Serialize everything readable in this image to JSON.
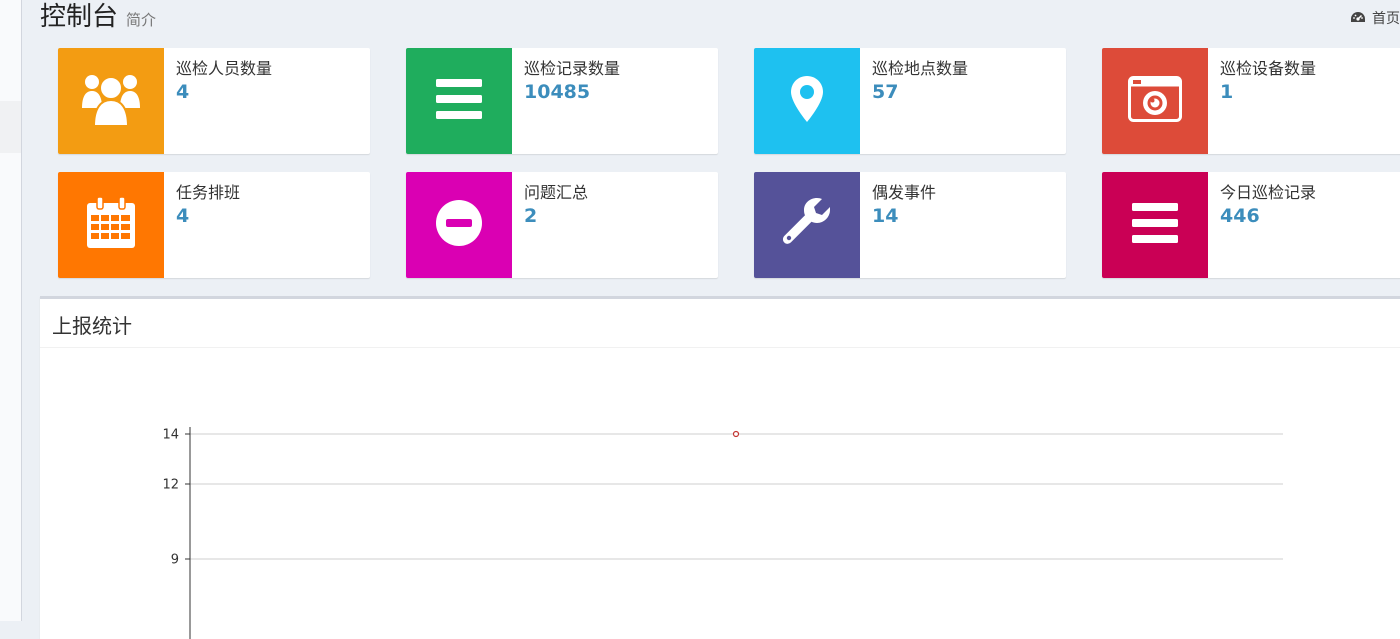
{
  "header": {
    "title": "控制台",
    "subtitle": "简介"
  },
  "breadcrumb": {
    "icon": "dashboard-icon",
    "label": "首页"
  },
  "info_boxes": [
    {
      "label": "巡检人员数量",
      "value": "4",
      "color": "#f39c12",
      "icon": "users-icon"
    },
    {
      "label": "巡检记录数量",
      "value": "10485",
      "color": "#1fad5d",
      "icon": "list-icon"
    },
    {
      "label": "巡检地点数量",
      "value": "57",
      "color": "#1ec1f0",
      "icon": "map-marker-icon"
    },
    {
      "label": "巡检设备数量",
      "value": "1",
      "color": "#dd4b39",
      "icon": "camera-icon"
    },
    {
      "label": "任务排班",
      "value": "4",
      "color": "#ff7701",
      "icon": "calendar-icon"
    },
    {
      "label": "问题汇总",
      "value": "2",
      "color": "#da00b3",
      "icon": "minus-circle-icon"
    },
    {
      "label": "偶发事件",
      "value": "14",
      "color": "#555299",
      "icon": "wrench-icon"
    },
    {
      "label": "今日巡检记录",
      "value": "446",
      "color": "#ca0055",
      "icon": "list-icon"
    }
  ],
  "panel": {
    "title": "上报统计"
  },
  "chart_data": {
    "type": "scatter",
    "y_ticks": [
      14,
      12,
      9
    ],
    "points": [
      {
        "y": 14
      }
    ],
    "point_color": "#c23531",
    "grid": true
  }
}
